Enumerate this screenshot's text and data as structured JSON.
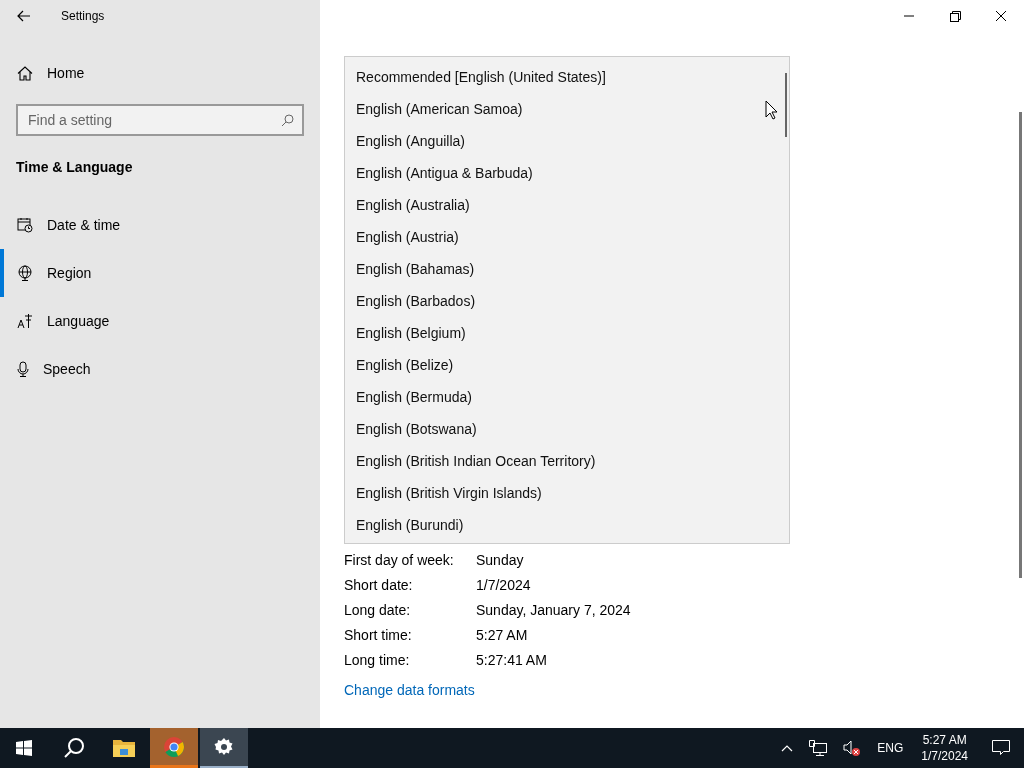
{
  "window": {
    "title": "Settings"
  },
  "sidebar": {
    "home": "Home",
    "search": {
      "placeholder": "Find a setting"
    },
    "section": "Time & Language",
    "items": [
      {
        "kind": "datetime",
        "label": "Date & time",
        "selected": false
      },
      {
        "kind": "region",
        "label": "Region",
        "selected": true
      },
      {
        "kind": "language",
        "label": "Language",
        "selected": false
      },
      {
        "kind": "speech",
        "label": "Speech",
        "selected": false
      }
    ]
  },
  "dropdown": {
    "options": [
      {
        "label": "Recommended [English (United States)]",
        "selected": false
      },
      {
        "label": "English (American Samoa)",
        "selected": false
      },
      {
        "label": "English (Anguilla)",
        "selected": false
      },
      {
        "label": "English (Antigua & Barbuda)",
        "selected": false
      },
      {
        "label": "English (Australia)",
        "selected": false
      },
      {
        "label": "English (Austria)",
        "selected": false
      },
      {
        "label": "English (Bahamas)",
        "selected": false
      },
      {
        "label": "English (Barbados)",
        "selected": false
      },
      {
        "label": "English (Belgium)",
        "selected": false
      },
      {
        "label": "English (Belize)",
        "selected": false
      },
      {
        "label": "English (Bermuda)",
        "selected": false
      },
      {
        "label": "English (Botswana)",
        "selected": false
      },
      {
        "label": "English (British Indian Ocean Territory)",
        "selected": false
      },
      {
        "label": "English (British Virgin Islands)",
        "selected": false
      },
      {
        "label": "English (Burundi)",
        "selected": false
      }
    ]
  },
  "formats": [
    {
      "label": "First day of week:",
      "value": "Sunday"
    },
    {
      "label": "Short date:",
      "value": "1/7/2024"
    },
    {
      "label": "Long date:",
      "value": "Sunday, January 7, 2024"
    },
    {
      "label": "Short time:",
      "value": "5:27 AM"
    },
    {
      "label": "Long time:",
      "value": "5:27:41 AM"
    }
  ],
  "link": "Change data formats",
  "taskbar": {
    "apps": [
      {
        "kind": "start",
        "active": false,
        "attention": false
      },
      {
        "kind": "search",
        "active": false,
        "attention": false
      },
      {
        "kind": "explorer",
        "active": false,
        "attention": false
      },
      {
        "kind": "chrome",
        "active": false,
        "attention": true
      },
      {
        "kind": "settings",
        "active": true,
        "attention": false
      }
    ],
    "language": "ENG",
    "time": "5:27 AM",
    "date": "1/7/2024"
  }
}
